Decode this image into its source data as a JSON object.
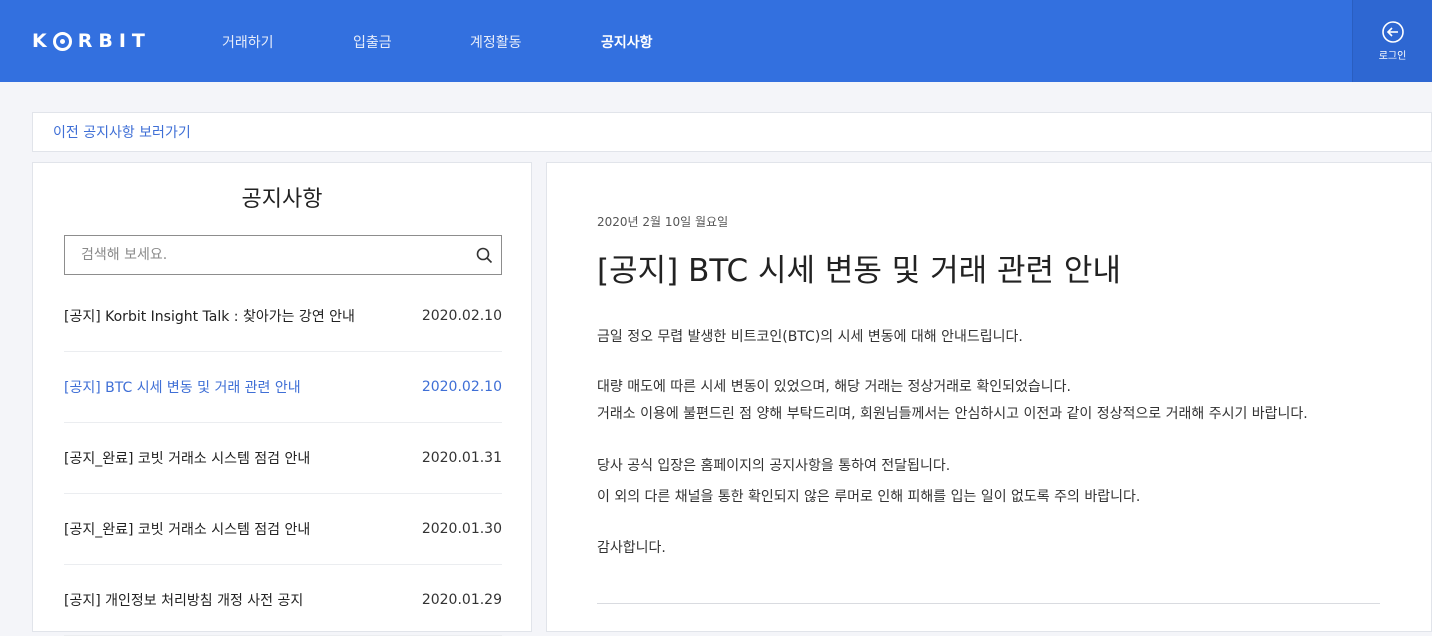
{
  "header": {
    "logo": "KORBIT",
    "nav": [
      {
        "label": "거래하기"
      },
      {
        "label": "입출금"
      },
      {
        "label": "계정활동"
      },
      {
        "label": "공지사항"
      }
    ],
    "login_label": "로그인"
  },
  "prev_link": "이전 공지사항 보러가기",
  "sidebar": {
    "title": "공지사항",
    "search_placeholder": "검색해 보세요.",
    "notices": [
      {
        "title": "[공지] Korbit Insight Talk : 찾아가는 강연 안내",
        "date": "2020.02.10"
      },
      {
        "title": "[공지] BTC 시세 변동 및 거래 관련 안내",
        "date": "2020.02.10"
      },
      {
        "title": "[공지_완료] 코빗 거래소 시스템 점검 안내",
        "date": "2020.01.31"
      },
      {
        "title": "[공지_완료] 코빗 거래소 시스템 점검 안내",
        "date": "2020.01.30"
      },
      {
        "title": "[공지] 개인정보 처리방침 개정 사전 공지",
        "date": "2020.01.29"
      }
    ]
  },
  "article": {
    "date": "2020년 2월 10일 월요일",
    "title": "[공지] BTC 시세 변동 및 거래 관련 안내",
    "paragraphs": [
      "금일 정오 무렵 발생한 비트코인(BTC)의 시세 변동에 대해 안내드립니다.",
      "대량 매도에 따른 시세 변동이 있었으며, 해당 거래는 정상거래로 확인되었습니다.",
      "거래소 이용에 불편드린 점 양해 부탁드리며, 회원님들께서는 안심하시고 이전과 같이 정상적으로 거래해 주시기 바랍니다.",
      "당사 공식 입장은 홈페이지의 공지사항을 통하여 전달됩니다.",
      "이 외의 다른 채널을 통한 확인되지 않은 루머로 인해 피해를 입는 일이 없도록 주의 바랍니다.",
      "감사합니다."
    ]
  },
  "colors": {
    "brand": "#3370df",
    "link": "#3f6fd6"
  }
}
